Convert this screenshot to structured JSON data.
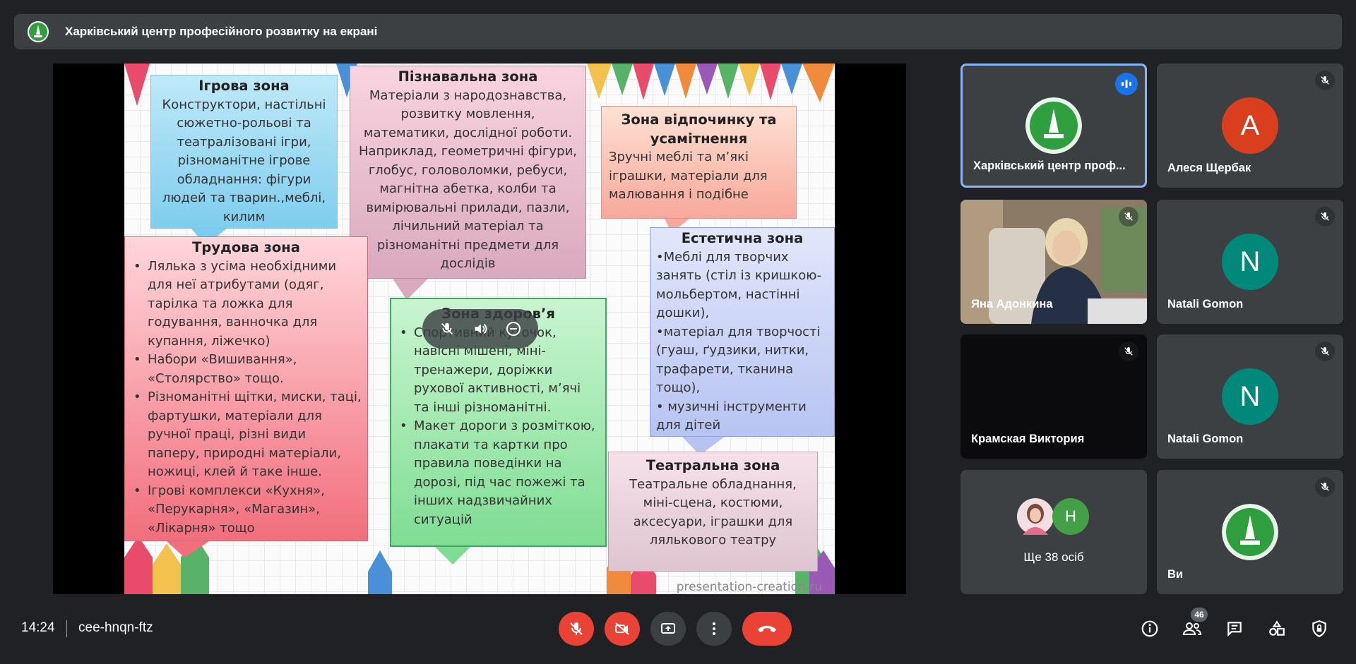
{
  "banner": {
    "title": "Харківський центр професійного розвитку на екрані",
    "logo_icon": "green-emblem-icon"
  },
  "slide": {
    "game": {
      "title": "Ігрова зона",
      "text": "Конструктори, настільні сюжетно-рольові та театралізовані ігри, різноманітне ігрове обладнання: фігури людей та тварин.,меблі, килим"
    },
    "knowledge": {
      "title": "Пізнавальна зона",
      "text": "Матеріали з народознавства, розвитку мовлення, математики, дослідної роботи. Наприклад, геометричні фігури, глобус, головоломки, ребуси, магнітна абетка, колби та вимірювальні прилади, пазли, лічильний матеріал та різноманітні предмети для дослідів"
    },
    "rest": {
      "title": "Зона відпочинку та усамітнення",
      "text": "Зручні меблі та м’які іграшки, матеріали для малювання і подібне"
    },
    "labor": {
      "title": "Трудова зона",
      "items": [
        "Лялька з усіма необхідними для неї атрибутами (одяг, тарілка та ложка для годування, ванночка для купання, ліжечко)",
        "Набори «Вишивання», «Столярство» тощо.",
        "Різноманітні щітки, миски, таці, фартушки, матеріали для ручної праці, різні види паперу, природні матеріали, ножиці, клей й таке інше.",
        "Ігрові комплекси «Кухня», «Перукарня», «Магазин», «Лікарня» тощо"
      ]
    },
    "health": {
      "title": "Зона здоров’я",
      "items": [
        "Спортивний куточок, навісні мішені, міні-тренажери, доріжки рухової активності, м’ячі та інші різноманітні.",
        "Макет дороги з розміткою, плакати та картки про правила поведінки на дорозі, під час пожежі та інших надзвичайних ситуацій"
      ]
    },
    "aesthetic": {
      "title": "Естетична зона",
      "items": [
        "•Меблі для творчих занять (стіл із кришкою-мольбертом, настінні дошки),",
        "•матеріал для творчості (гуаш, ґудзики, нитки, трафарети, тканина тощо),",
        "• музичні інструменти для дітей"
      ]
    },
    "theater": {
      "title": "Театральна зона",
      "text": "Театральне обладнання, міні-сцена, костюми, аксесуари, іграшки для лялькового театру"
    },
    "watermark": "presentation-creation.ru"
  },
  "media_controls": [
    "mic-off-icon",
    "volume-icon",
    "minus-circle-icon"
  ],
  "tiles": [
    {
      "name": "Харківський центр проф...",
      "avatar_icon": "green-emblem-icon",
      "state": "speaking"
    },
    {
      "name": "Алеся Щербак",
      "initial": "A",
      "color": "#d93f1e"
    },
    {
      "name": "Яна Адонкина",
      "state": "video"
    },
    {
      "name": "Natali Gomon",
      "initial": "N",
      "color": "#00897b"
    },
    {
      "name": "Крамская Виктория",
      "state": "camera-off"
    },
    {
      "name": "Natali Gomon",
      "initial": "N",
      "color": "#00897b"
    },
    {
      "name": "Ще 38 осіб",
      "mini_initial": "Н",
      "mini_color": "#43a047"
    },
    {
      "name": "Ви",
      "avatar_icon": "green-emblem-icon"
    }
  ],
  "bottom": {
    "time": "14:24",
    "meeting_code": "cee-hnqn-ftz",
    "participants_count": "46",
    "colors": {
      "end_call": "#ea4335",
      "muted": "#ea4335",
      "control": "#3c4043"
    }
  }
}
